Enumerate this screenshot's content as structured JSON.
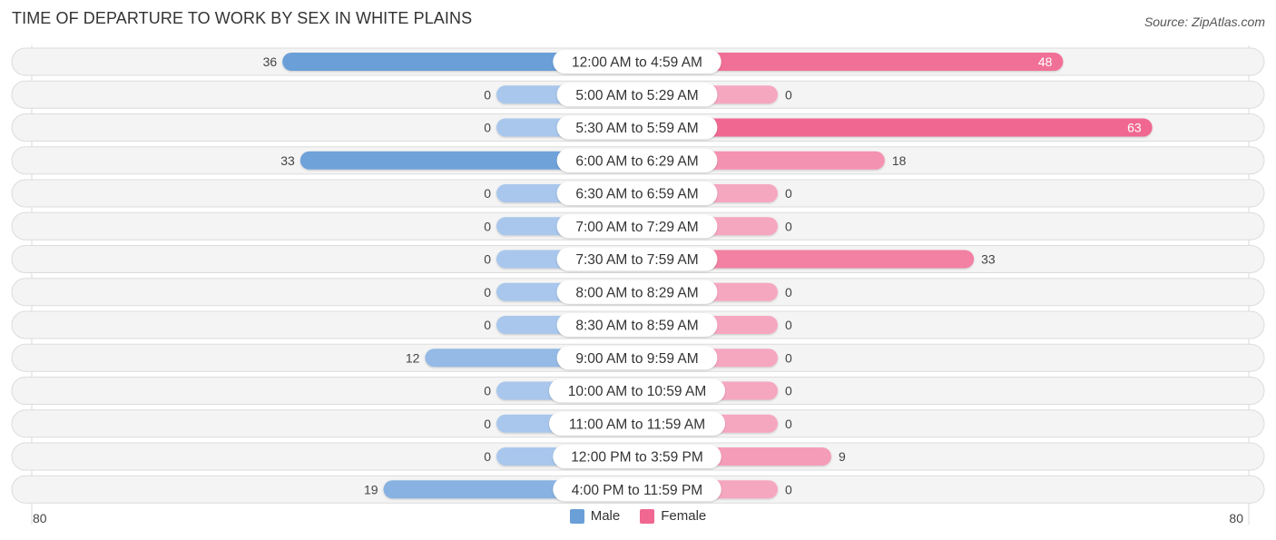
{
  "title": "TIME OF DEPARTURE TO WORK BY SEX IN WHITE PLAINS",
  "source": "Source: ZipAtlas.com",
  "colors": {
    "male": "#6a9fd8",
    "male_light": "#a9c7ec",
    "female": "#f06792",
    "female_light": "#f6a7c0"
  },
  "chart_data": {
    "type": "bar",
    "orientation": "horizontal-diverging",
    "title": "TIME OF DEPARTURE TO WORK BY SEX IN WHITE PLAINS",
    "categories": [
      "12:00 AM to 4:59 AM",
      "5:00 AM to 5:29 AM",
      "5:30 AM to 5:59 AM",
      "6:00 AM to 6:29 AM",
      "6:30 AM to 6:59 AM",
      "7:00 AM to 7:29 AM",
      "7:30 AM to 7:59 AM",
      "8:00 AM to 8:29 AM",
      "8:30 AM to 8:59 AM",
      "9:00 AM to 9:59 AM",
      "10:00 AM to 10:59 AM",
      "11:00 AM to 11:59 AM",
      "12:00 PM to 3:59 PM",
      "4:00 PM to 11:59 PM"
    ],
    "series": [
      {
        "name": "Male",
        "values": [
          36,
          0,
          0,
          33,
          0,
          0,
          0,
          0,
          0,
          12,
          0,
          0,
          0,
          19
        ]
      },
      {
        "name": "Female",
        "values": [
          48,
          0,
          63,
          18,
          0,
          0,
          33,
          0,
          0,
          0,
          0,
          0,
          9,
          0
        ]
      }
    ],
    "axis": {
      "left_label": "80",
      "right_label": "80",
      "range": [
        -80,
        80
      ]
    },
    "legend": {
      "position": "bottom-center",
      "entries": [
        "Male",
        "Female"
      ]
    }
  }
}
